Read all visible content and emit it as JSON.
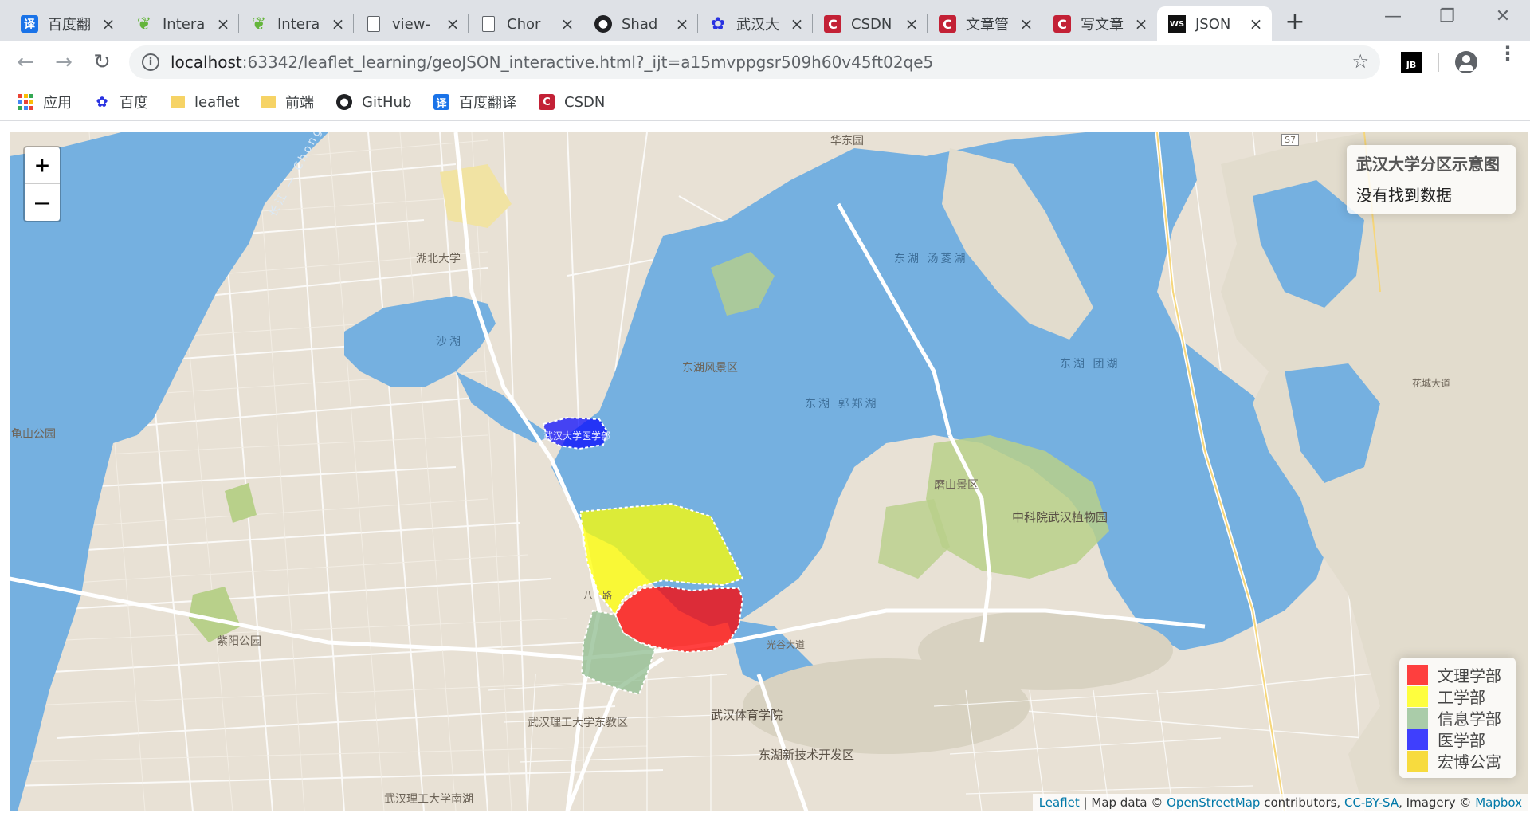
{
  "browser": {
    "tabs": [
      {
        "title": "百度翻",
        "favicon": "fanyi-icon",
        "active": false
      },
      {
        "title": "Intera",
        "favicon": "leaflet-icon",
        "active": false
      },
      {
        "title": "Intera",
        "favicon": "leaflet-icon",
        "active": false
      },
      {
        "title": "view-",
        "favicon": "document-icon",
        "active": false
      },
      {
        "title": "Chor",
        "favicon": "document-icon",
        "active": false
      },
      {
        "title": "Shad",
        "favicon": "github-icon",
        "active": false
      },
      {
        "title": "武汉大",
        "favicon": "baidu-icon",
        "active": false
      },
      {
        "title": "CSDN",
        "favicon": "csdn-icon",
        "active": false
      },
      {
        "title": "文章管",
        "favicon": "csdn-icon",
        "active": false
      },
      {
        "title": "写文章",
        "favicon": "csdn-icon",
        "active": false
      },
      {
        "title": "JSON",
        "favicon": "webstorm-icon",
        "active": true
      }
    ],
    "url_host": "localhost",
    "url_rest": ":63342/leaflet_learning/geoJSON_interactive.html?_ijt=a15mvppgsr509h60v45ft02qe5",
    "bookmarks": [
      {
        "label": "应用",
        "icon": "apps-icon"
      },
      {
        "label": "百度",
        "icon": "baidu-icon"
      },
      {
        "label": "leaflet",
        "icon": "folder-icon"
      },
      {
        "label": "前端",
        "icon": "folder-icon"
      },
      {
        "label": "GitHub",
        "icon": "github-icon"
      },
      {
        "label": "百度翻译",
        "icon": "fanyi-icon"
      },
      {
        "label": "CSDN",
        "icon": "csdn-icon"
      }
    ]
  },
  "map": {
    "zoom_in": "+",
    "zoom_out": "–",
    "info": {
      "title": "武汉大学分区示意图",
      "text": "没有找到数据"
    },
    "legend": [
      {
        "label": "文理学部",
        "color": "#ff0000"
      },
      {
        "label": "工学部",
        "color": "#ffff00"
      },
      {
        "label": "信息学部",
        "color": "#8fbc8f"
      },
      {
        "label": "医学部",
        "color": "#0000ff"
      },
      {
        "label": "宏博公寓",
        "color": "#f5d000"
      }
    ],
    "attribution": {
      "leaflet": "Leaflet",
      "sep": " | Map data © ",
      "osm": "OpenStreetMap",
      "contrib": " contributors, ",
      "ccbysa": "CC-BY-SA",
      "imagery": ", Imagery © ",
      "mapbox": "Mapbox"
    },
    "labels": [
      {
        "text": "湖北大学",
        "kind": "place"
      },
      {
        "text": "沙湖",
        "kind": "water"
      },
      {
        "text": "东湖 汤菱湖",
        "kind": "water"
      },
      {
        "text": "东湖风景区",
        "kind": "place"
      },
      {
        "text": "东湖 郭郑湖",
        "kind": "water"
      },
      {
        "text": "东湖 团湖",
        "kind": "water"
      },
      {
        "text": "磨山景区",
        "kind": "place"
      },
      {
        "text": "中科院武汉植物园",
        "kind": "place"
      },
      {
        "text": "武汉大学医学部",
        "kind": "place"
      },
      {
        "text": "武汉体育学院",
        "kind": "place"
      },
      {
        "text": "东湖新技术开发区",
        "kind": "place"
      },
      {
        "text": "武汉理工大学东教区",
        "kind": "place"
      },
      {
        "text": "武汉理工大学南湖",
        "kind": "place"
      },
      {
        "text": "紫阳公园",
        "kind": "place"
      },
      {
        "text": "龟山公园",
        "kind": "place"
      },
      {
        "text": "长江 — Chong Jiang",
        "kind": "water"
      },
      {
        "text": "华东园",
        "kind": "place"
      },
      {
        "text": "S7",
        "kind": "shield"
      },
      {
        "text": "八一路",
        "kind": "road"
      },
      {
        "text": "光谷大道",
        "kind": "road"
      },
      {
        "text": "花城大道",
        "kind": "road"
      }
    ]
  }
}
